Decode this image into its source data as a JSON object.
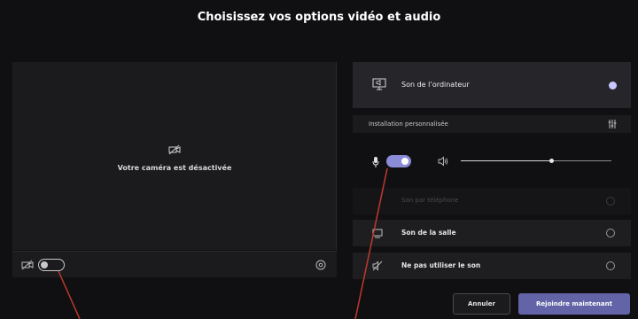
{
  "header": {
    "title": "Choisissez vos options vidéo et audio"
  },
  "preview": {
    "camera_off_text": "Votre caméra est désactivée",
    "camera_toggle_on": false
  },
  "audio": {
    "computer_sound_label": "Son de l’ordinateur",
    "custom_setup_label": "Installation personnalisée",
    "mic_toggle_on": true,
    "speaker_volume": 0.6,
    "phone_sound_label": "Son par téléphone",
    "room_sound_label": "Son de la salle",
    "no_sound_label": "Ne pas utiliser le son"
  },
  "actions": {
    "cancel_label": "Annuler",
    "join_label": "Rejoindre maintenant"
  },
  "colors": {
    "accent": "#6264a7",
    "toggle_on": "#8b8cd8",
    "background": "#101013"
  },
  "icons": [
    "camera-off-icon",
    "camera-icon",
    "settings-icon",
    "computer-audio-icon",
    "check-icon",
    "equalizer-icon",
    "mic-icon",
    "speaker-icon",
    "phone-icon",
    "room-icon",
    "no-audio-icon"
  ]
}
